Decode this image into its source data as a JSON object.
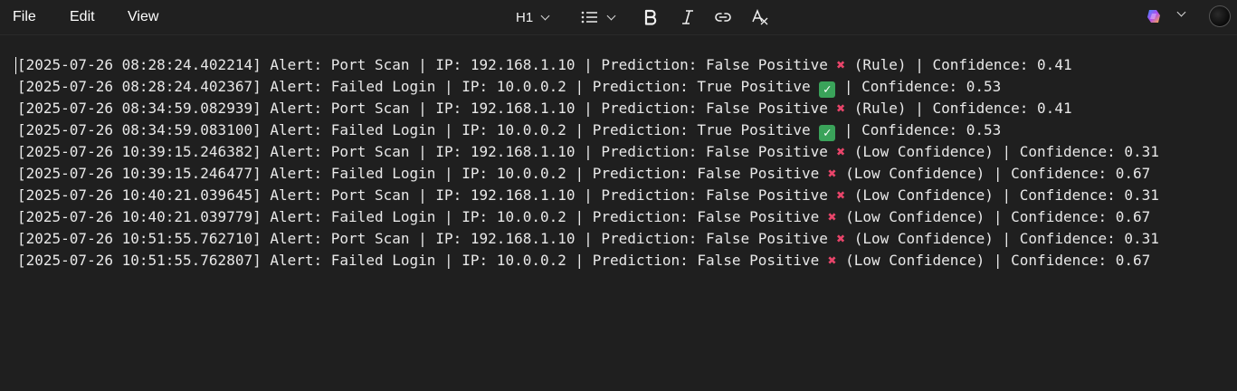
{
  "menu": {
    "file": "File",
    "edit": "Edit",
    "view": "View"
  },
  "toolbar": {
    "heading": "H1",
    "icons": [
      "list-icon",
      "bold-icon",
      "italic-icon",
      "link-icon",
      "clear-format-icon",
      "copilot-icon",
      "avatar"
    ]
  },
  "log": {
    "lines": [
      {
        "text": "[2025-07-26 08:28:24.402214] Alert: Port Scan | IP: 192.168.1.10 | Prediction: False Positive ",
        "mark": "x",
        "rest": " (Rule) | Confidence: 0.41"
      },
      {
        "text": "[2025-07-26 08:28:24.402367] Alert: Failed Login | IP: 10.0.0.2 | Prediction: True Positive ",
        "mark": "check",
        "rest": " | Confidence: 0.53"
      },
      {
        "text": "[2025-07-26 08:34:59.082939] Alert: Port Scan | IP: 192.168.1.10 | Prediction: False Positive ",
        "mark": "x",
        "rest": " (Rule) | Confidence: 0.41"
      },
      {
        "text": "[2025-07-26 08:34:59.083100] Alert: Failed Login | IP: 10.0.0.2 | Prediction: True Positive ",
        "mark": "check",
        "rest": " | Confidence: 0.53"
      },
      {
        "text": "[2025-07-26 10:39:15.246382] Alert: Port Scan | IP: 192.168.1.10 | Prediction: False Positive ",
        "mark": "x",
        "rest": " (Low Confidence) | Confidence: 0.31"
      },
      {
        "text": "[2025-07-26 10:39:15.246477] Alert: Failed Login | IP: 10.0.0.2 | Prediction: False Positive ",
        "mark": "x",
        "rest": " (Low Confidence) | Confidence: 0.67"
      },
      {
        "text": "[2025-07-26 10:40:21.039645] Alert: Port Scan | IP: 192.168.1.10 | Prediction: False Positive ",
        "mark": "x",
        "rest": " (Low Confidence) | Confidence: 0.31"
      },
      {
        "text": "[2025-07-26 10:40:21.039779] Alert: Failed Login | IP: 10.0.0.2 | Prediction: False Positive ",
        "mark": "x",
        "rest": " (Low Confidence) | Confidence: 0.67"
      },
      {
        "text": "[2025-07-26 10:51:55.762710] Alert: Port Scan | IP: 192.168.1.10 | Prediction: False Positive ",
        "mark": "x",
        "rest": " (Low Confidence) | Confidence: 0.31"
      },
      {
        "text": "[2025-07-26 10:51:55.762807] Alert: Failed Login | IP: 10.0.0.2 | Prediction: False Positive ",
        "mark": "x",
        "rest": " (Low Confidence) | Confidence: 0.67"
      }
    ]
  },
  "colors": {
    "background": "#1f1f1f",
    "text": "#e8e8e8",
    "x_mark": "#e8456a",
    "check_mark": "#3aa35a"
  }
}
